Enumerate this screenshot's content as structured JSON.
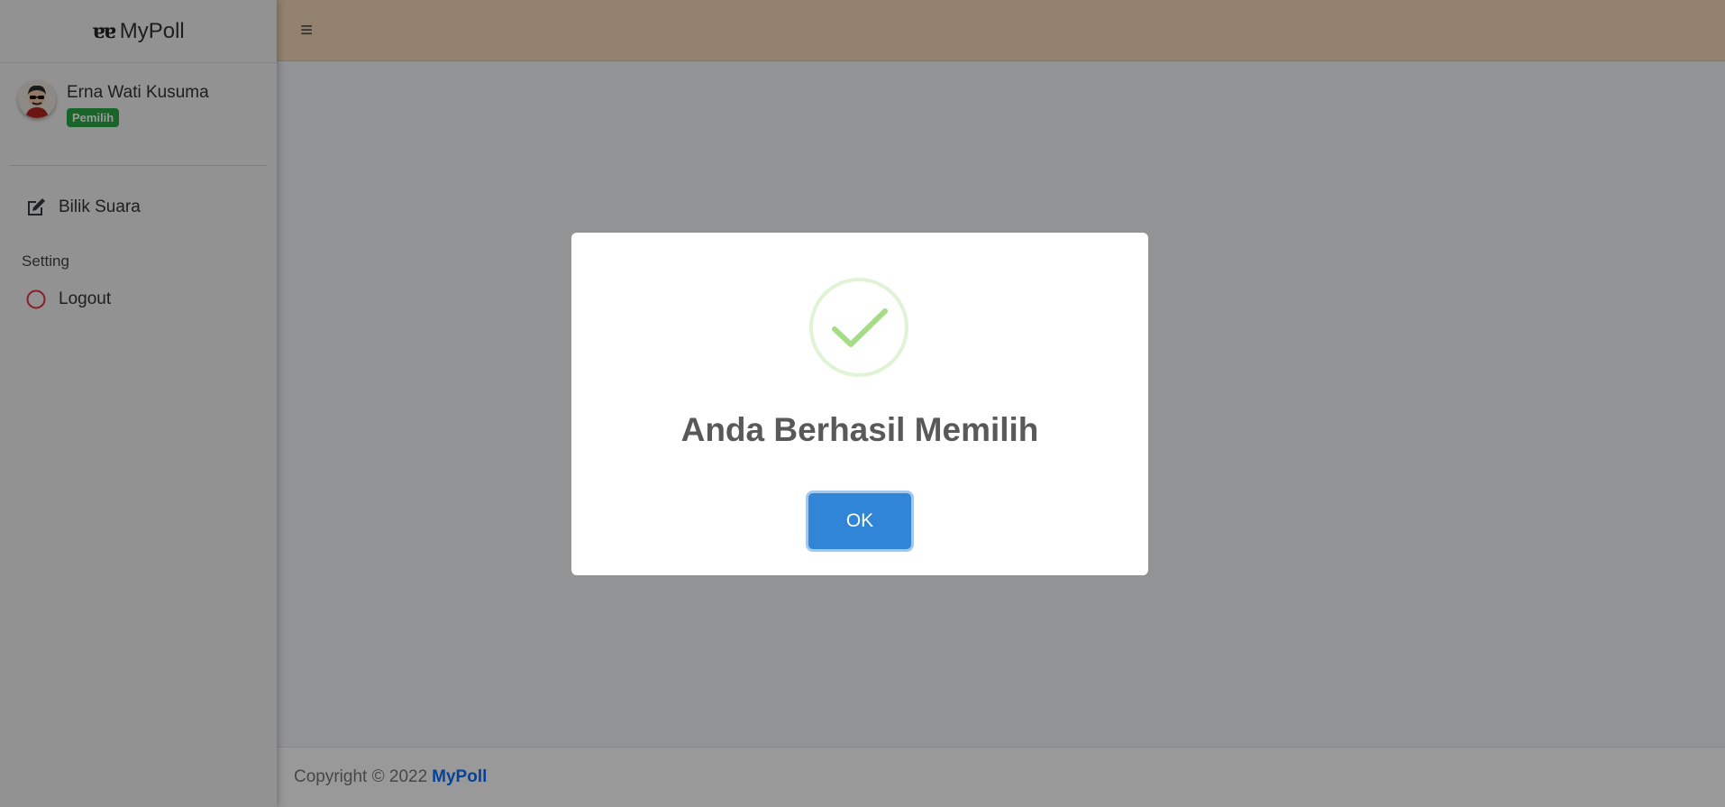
{
  "brand": {
    "logo_glyph": "ɐɐ",
    "name": "MyPoll"
  },
  "user": {
    "name": "Erna Wati Kusuma",
    "role_badge": "Pemilih"
  },
  "sidebar": {
    "items": [
      {
        "label": "Bilik Suara",
        "icon": "edit-icon"
      }
    ],
    "section_header": "Setting",
    "settings_items": [
      {
        "label": "Logout",
        "icon": "circle-icon",
        "icon_color": "#dc3545"
      }
    ]
  },
  "topbar": {
    "menu_icon": "≡"
  },
  "footer": {
    "text": "Copyright © 2022",
    "brand_link": "MyPoll"
  },
  "dialog": {
    "icon": "success-check-icon",
    "title": "Anda Berhasil Memilih",
    "confirm_label": "OK"
  },
  "colors": {
    "topbar": "#f6d9b9",
    "badge": "#28a745",
    "ok_button": "#3085d6",
    "success_icon": "#a5dc86",
    "footer_link": "#0d6efd"
  }
}
